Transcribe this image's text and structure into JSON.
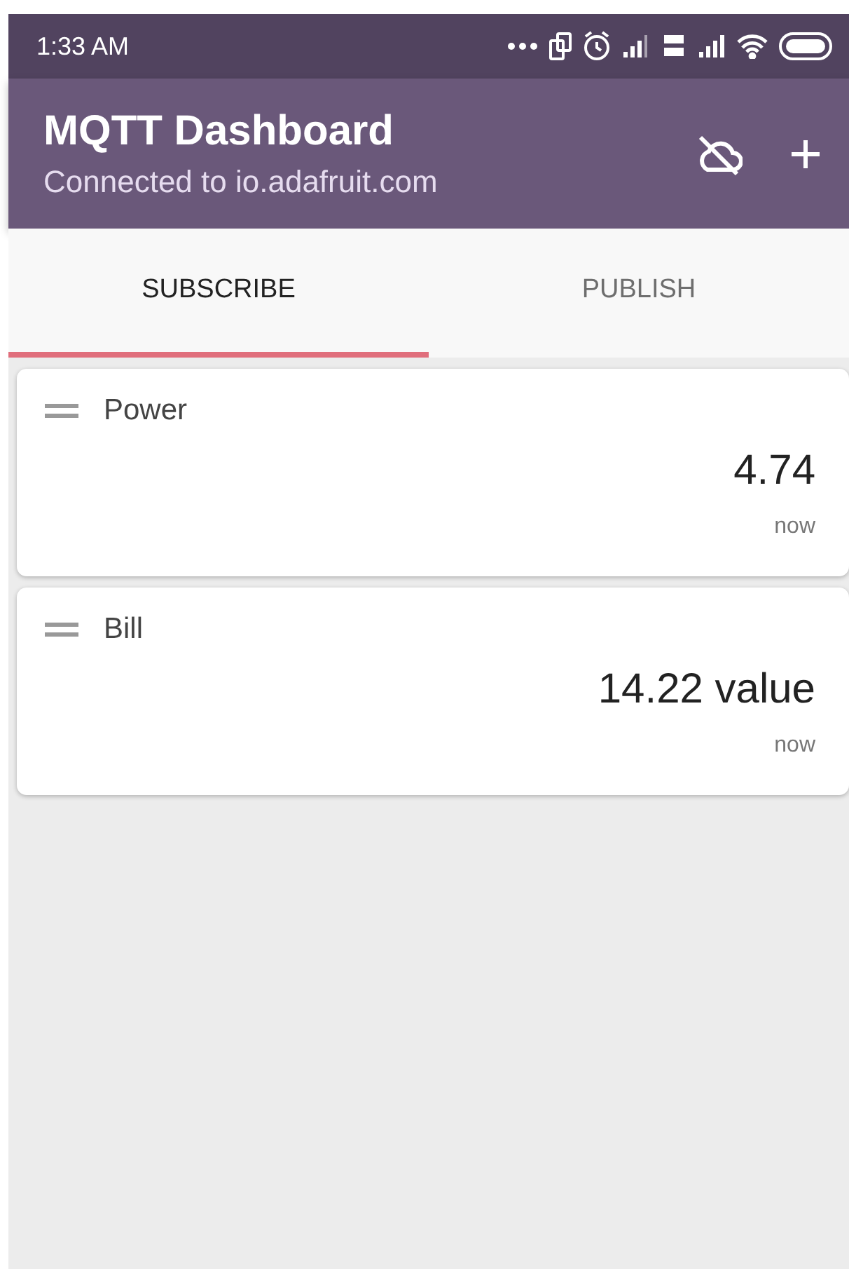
{
  "status_bar": {
    "time": "1:33 AM"
  },
  "app_bar": {
    "title": "MQTT Dashboard",
    "subtitle": "Connected to io.adafruit.com"
  },
  "tabs": [
    {
      "label": "SUBSCRIBE",
      "selected": true
    },
    {
      "label": "PUBLISH",
      "selected": false
    }
  ],
  "cards": [
    {
      "name": "Power",
      "value": "4.74",
      "time": "now"
    },
    {
      "name": "Bill",
      "value": "14.22 value",
      "time": "now"
    }
  ]
}
